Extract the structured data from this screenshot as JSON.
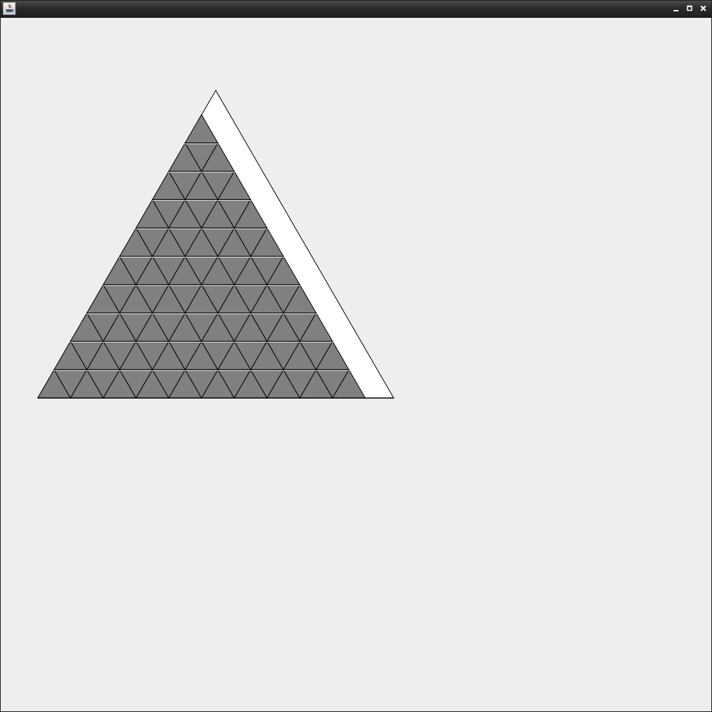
{
  "window": {
    "icon": "java-app-icon",
    "controls": [
      "minimize-icon",
      "maximize-icon",
      "close-icon"
    ]
  },
  "board": {
    "rows": 10,
    "outline_color": "#000000",
    "outer_fill": "#ffffff",
    "tile_fill": "#808080",
    "tile_stroke": "#000000",
    "background": "#eeeeee"
  }
}
